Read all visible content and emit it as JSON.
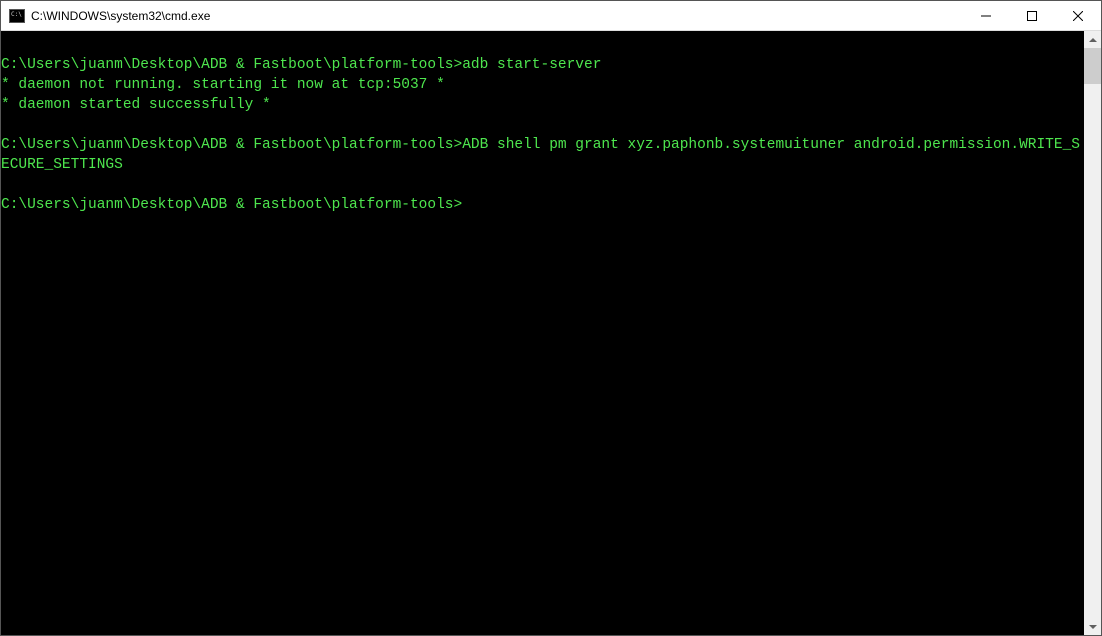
{
  "titlebar": {
    "title": "C:\\WINDOWS\\system32\\cmd.exe"
  },
  "terminal": {
    "lines": [
      {
        "type": "blank",
        "text": ""
      },
      {
        "type": "cmd",
        "prompt": "C:\\Users\\juanm\\Desktop\\ADB & Fastboot\\platform-tools>",
        "command": "adb start-server"
      },
      {
        "type": "out",
        "text": "* daemon not running. starting it now at tcp:5037 *"
      },
      {
        "type": "out",
        "text": "* daemon started successfully *"
      },
      {
        "type": "blank",
        "text": ""
      },
      {
        "type": "cmd",
        "prompt": "C:\\Users\\juanm\\Desktop\\ADB & Fastboot\\platform-tools>",
        "command": "ADB shell pm grant xyz.paphonb.systemuituner android.permission.WRITE_SECURE_SETTINGS"
      },
      {
        "type": "blank",
        "text": ""
      },
      {
        "type": "cmd",
        "prompt": "C:\\Users\\juanm\\Desktop\\ADB & Fastboot\\platform-tools>",
        "command": ""
      }
    ]
  }
}
